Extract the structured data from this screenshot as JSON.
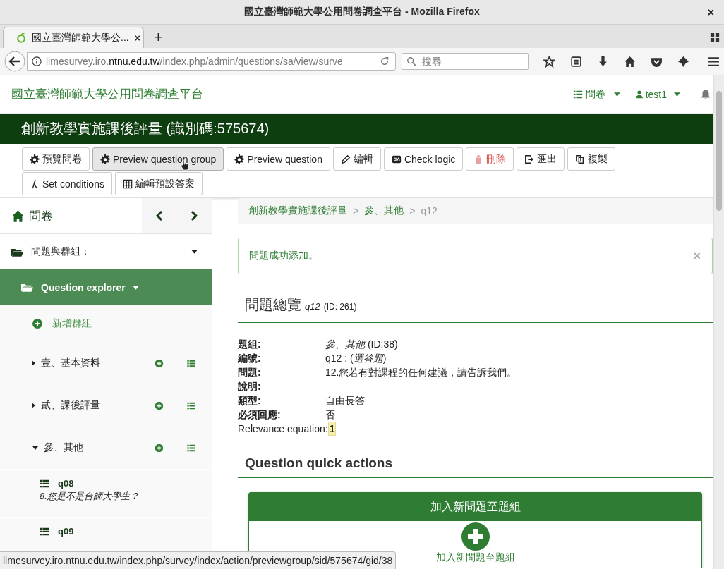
{
  "window": {
    "title": "國立臺灣師範大學公用問卷調查平台 - Mozilla Firefox",
    "close": "×"
  },
  "tabs": [
    {
      "label": "國立臺灣師範大學公...",
      "selected": true,
      "close": "×"
    }
  ],
  "new_tab": "+",
  "address_bar": {
    "url": "limesurvey.iro.**ntnu.edu.tw**/index.php/admin/questions/sa/view/surve"
  },
  "search": {
    "placeholder": "搜尋"
  },
  "app_header": {
    "brand": "國立臺灣師範大學公用問卷調查平台",
    "surveys_menu": "問卷",
    "user_menu": "test1"
  },
  "survey_title": "創新教學實施課後評量 (識別碼:575674)",
  "toolbar": [
    {
      "label": "預覽問卷",
      "kind": "normal",
      "hovered": false
    },
    {
      "label": "Preview question group",
      "kind": "normal",
      "hovered": true
    },
    {
      "label": "Preview question",
      "kind": "normal",
      "hovered": false
    },
    {
      "label": "編輯",
      "kind": "normal",
      "hovered": false
    },
    {
      "label": "Check logic",
      "kind": "normal",
      "hovered": false
    },
    {
      "label": "刪除",
      "kind": "danger",
      "hovered": false
    },
    {
      "label": "匯出",
      "kind": "normal",
      "hovered": false
    },
    {
      "label": "複製",
      "kind": "normal",
      "hovered": false
    },
    {
      "label": "Set conditions",
      "kind": "normal",
      "hovered": false
    },
    {
      "label": "編輯預設答案",
      "kind": "normal",
      "hovered": false
    }
  ],
  "sidebar": {
    "title": "問卷",
    "section": "問題與群組：",
    "explorer": "Question explorer",
    "add_group": "新增群組",
    "groups": [
      {
        "label": "壹、基本資料",
        "expanded": false
      },
      {
        "label": "貳、課後評量",
        "expanded": false
      },
      {
        "label": "參、其他",
        "expanded": true,
        "children": [
          {
            "code": "q08",
            "text": "8.您是不是台師大學生？"
          },
          {
            "code": "q09"
          }
        ]
      }
    ]
  },
  "breadcrumb": [
    {
      "label": "創新教學實施課後評量",
      "current": false
    },
    {
      "separator": ">",
      "label": "參、其他",
      "current": false
    },
    {
      "separator": ">",
      "label": "q12",
      "current": true
    }
  ],
  "alert": {
    "message": "問題成功添加。",
    "close": "×"
  },
  "overview": {
    "title": "問題總覽",
    "code": "q12",
    "id": "(ID: 261)",
    "rows": [
      {
        "label": "題組:",
        "value": "*參、其他* (ID:38)",
        "kind": "plain"
      },
      {
        "label": "編號:",
        "value": "q12 : (*選答題*)",
        "kind": "plain"
      },
      {
        "label": "問題:",
        "value": "12.您若有對課程的任何建議，請告訴我們。",
        "kind": "plain"
      },
      {
        "label": "說明:",
        "kind": "plain"
      },
      {
        "label": "類型:",
        "value": "自由長答",
        "kind": "plain"
      },
      {
        "label": "必須回應:",
        "value": "否",
        "kind": "plain"
      },
      {
        "label": "Relevance equation:",
        "value": "1",
        "kind": "highlight"
      }
    ]
  },
  "quick_actions": {
    "title": "Question quick actions",
    "card_title": "加入新問題至題組",
    "card_link": "加入新問題至題組"
  },
  "status_bar": "limesurvey.iro.ntnu.edu.tw/index.php/survey/index/action/previewgroup/sid/575674/gid/38"
}
